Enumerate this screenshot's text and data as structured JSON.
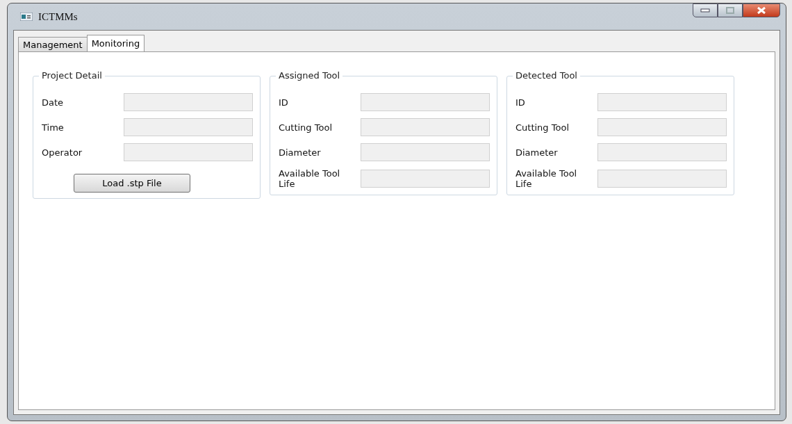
{
  "window": {
    "title": "ICTMMs"
  },
  "tabs": [
    {
      "label": "Management",
      "selected": false
    },
    {
      "label": "Monitoring",
      "selected": true
    }
  ],
  "groups": [
    {
      "title": "Project Detail",
      "fields": [
        {
          "label": "Date"
        },
        {
          "label": "Time"
        },
        {
          "label": "Operator"
        }
      ],
      "button": "Load .stp File"
    },
    {
      "title": "Assigned Tool",
      "fields": [
        {
          "label": "ID"
        },
        {
          "label": "Cutting Tool"
        },
        {
          "label": "Diameter"
        },
        {
          "label": "Available Tool Life"
        }
      ]
    },
    {
      "title": "Detected Tool",
      "fields": [
        {
          "label": "ID"
        },
        {
          "label": "Cutting Tool"
        },
        {
          "label": "Diameter"
        },
        {
          "label": "Available Tool Life"
        }
      ]
    }
  ]
}
